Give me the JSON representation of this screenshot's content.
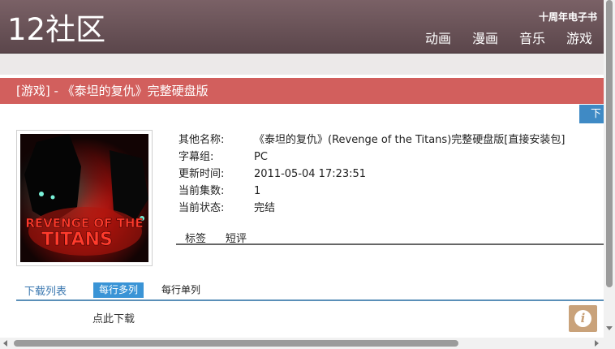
{
  "header": {
    "logo": "12社区",
    "top_link": "十周年电子书",
    "nav": [
      "动画",
      "漫画",
      "音乐",
      "游戏"
    ]
  },
  "title_bar": {
    "text": "[游戏] - 《泰坦的复仇》完整硬盘版"
  },
  "download_tab": {
    "label": "下载"
  },
  "cover": {
    "title_art": "REVENGE OF THE TITANS"
  },
  "info": [
    {
      "label": "其他名称:",
      "value": "《泰坦的复仇》(Revenge of the Titans)完整硬盘版[直接安装包]"
    },
    {
      "label": "字幕组:",
      "value": "PC"
    },
    {
      "label": "更新时间:",
      "value": "2011-05-04 17:23:51"
    },
    {
      "label": "当前集数:",
      "value": "1"
    },
    {
      "label": "当前状态:",
      "value": "完结"
    }
  ],
  "subtabs": [
    "标签",
    "短评"
  ],
  "download_list": {
    "title": "下载列表",
    "mode_multi": "每行多列",
    "mode_single": "每行单列",
    "link": "点此下载"
  },
  "info_button": {
    "glyph": "i"
  },
  "colors": {
    "header": "#6b5257",
    "title_bar": "#d25f5d",
    "accent_blue": "#3a94d6",
    "info_button": "#c9a27a"
  }
}
